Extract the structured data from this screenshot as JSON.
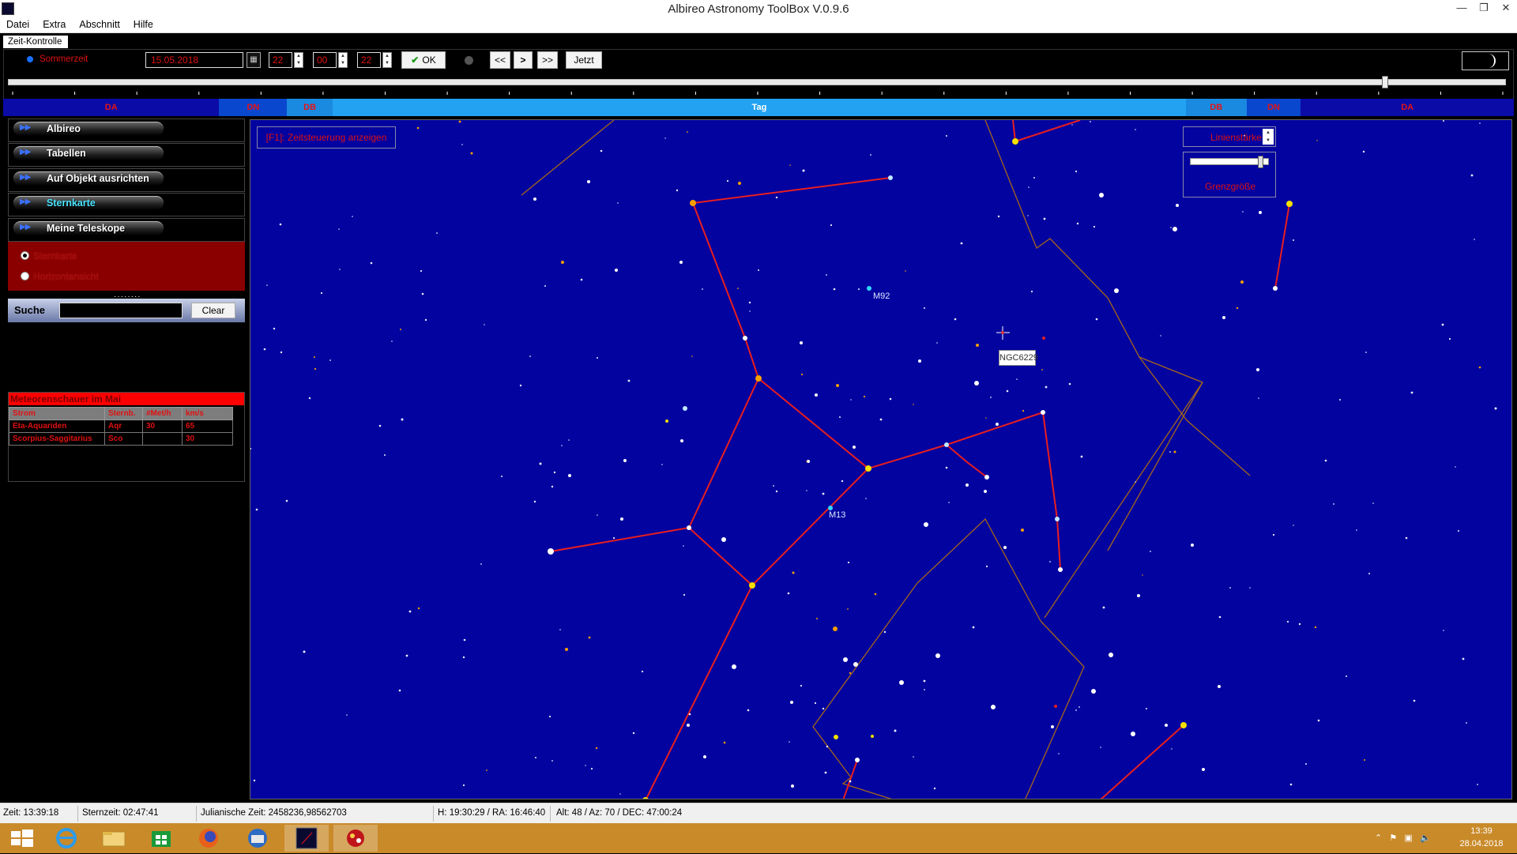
{
  "window": {
    "title": "Albireo Astronomy ToolBox V.0.9.6"
  },
  "menu": [
    "Datei",
    "Extra",
    "Abschnitt",
    "Hilfe"
  ],
  "zeit": {
    "panel_label": "Zeit-Kontrolle",
    "sommerzeit_label": "Sommerzeit",
    "date": "15.05.2018",
    "hour": "22",
    "minute": "00",
    "second": "22",
    "ok_label": "OK",
    "back_label": "<<",
    "play_label": ">",
    "forward_label": ">>",
    "now_label": "Jetzt",
    "slider_position": 0.917
  },
  "daybar": [
    {
      "label": "DA",
      "type": "da",
      "width": 0.143
    },
    {
      "label": "DN",
      "type": "dn",
      "width": 0.045
    },
    {
      "label": "DB",
      "type": "db",
      "width": 0.03
    },
    {
      "label": "Tag",
      "type": "tag",
      "width": 0.565
    },
    {
      "label": "DB",
      "type": "db",
      "width": 0.04
    },
    {
      "label": "DN",
      "type": "dn",
      "width": 0.036
    },
    {
      "label": "DA",
      "type": "da",
      "width": 0.141
    }
  ],
  "sidebar": {
    "nav": [
      {
        "label": "Albireo",
        "active": false
      },
      {
        "label": "Tabellen",
        "active": false
      },
      {
        "label": "Auf Objekt ausrichten",
        "active": false
      },
      {
        "label": "Sternkarte",
        "active": true
      },
      {
        "label": "Meine Teleskope",
        "active": false
      }
    ],
    "view_options": [
      {
        "label": "Sternkarte",
        "checked": true
      },
      {
        "label": "Horizontansicht",
        "checked": false
      }
    ],
    "search": {
      "label": "Suche",
      "value": "",
      "clear_label": "Clear"
    }
  },
  "meteor": {
    "title": "Meteorenschauer im Mai",
    "columns": [
      "Strom",
      "Sternb.",
      "#Met/h",
      "km/s"
    ],
    "rows": [
      [
        "Eta-Aquariden",
        "Aqr",
        "30",
        "65"
      ],
      [
        "Scorpius-Saggitarius",
        "Sco",
        "",
        "30"
      ]
    ]
  },
  "starmap": {
    "f1_label": "[F1]: Zeitsteuerung anzeigen",
    "linienstaerke_label": "Linienstärke",
    "grenzgroesse_label": "Grenzgröße",
    "grenzgroesse_value": 0.93,
    "objects": [
      {
        "label": "M92"
      },
      {
        "label": "M13"
      }
    ],
    "tooltip": "NGC6229",
    "colors": {
      "background": "#0303a0",
      "constellation_lines": "#e81e1e",
      "boundaries": "#a5661a"
    }
  },
  "status": {
    "zeit": "Zeit: 13:39:18",
    "sternzeit": "Sternzeit: 02:47:41",
    "julian": "Julianische Zeit: 2458236,98562703",
    "h_ra": "H: 19:30:29 / RA: 16:46:40",
    "alt_az_dec": "Alt: 48 / Az: 70 / DEC: 47:00:24"
  },
  "taskbar": {
    "apps": [
      "windows-start",
      "internet-explorer",
      "file-explorer",
      "store",
      "firefox",
      "thunderbird",
      "albireo",
      "paint-app"
    ],
    "clock_time": "13:39",
    "clock_date": "28.04.2018"
  }
}
